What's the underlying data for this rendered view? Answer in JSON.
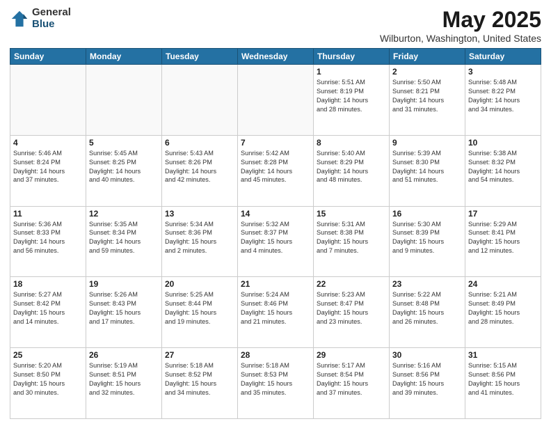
{
  "header": {
    "logo_general": "General",
    "logo_blue": "Blue",
    "title": "May 2025",
    "location": "Wilburton, Washington, United States"
  },
  "days_of_week": [
    "Sunday",
    "Monday",
    "Tuesday",
    "Wednesday",
    "Thursday",
    "Friday",
    "Saturday"
  ],
  "weeks": [
    [
      {
        "day": "",
        "info": ""
      },
      {
        "day": "",
        "info": ""
      },
      {
        "day": "",
        "info": ""
      },
      {
        "day": "",
        "info": ""
      },
      {
        "day": "1",
        "info": "Sunrise: 5:51 AM\nSunset: 8:19 PM\nDaylight: 14 hours\nand 28 minutes."
      },
      {
        "day": "2",
        "info": "Sunrise: 5:50 AM\nSunset: 8:21 PM\nDaylight: 14 hours\nand 31 minutes."
      },
      {
        "day": "3",
        "info": "Sunrise: 5:48 AM\nSunset: 8:22 PM\nDaylight: 14 hours\nand 34 minutes."
      }
    ],
    [
      {
        "day": "4",
        "info": "Sunrise: 5:46 AM\nSunset: 8:24 PM\nDaylight: 14 hours\nand 37 minutes."
      },
      {
        "day": "5",
        "info": "Sunrise: 5:45 AM\nSunset: 8:25 PM\nDaylight: 14 hours\nand 40 minutes."
      },
      {
        "day": "6",
        "info": "Sunrise: 5:43 AM\nSunset: 8:26 PM\nDaylight: 14 hours\nand 42 minutes."
      },
      {
        "day": "7",
        "info": "Sunrise: 5:42 AM\nSunset: 8:28 PM\nDaylight: 14 hours\nand 45 minutes."
      },
      {
        "day": "8",
        "info": "Sunrise: 5:40 AM\nSunset: 8:29 PM\nDaylight: 14 hours\nand 48 minutes."
      },
      {
        "day": "9",
        "info": "Sunrise: 5:39 AM\nSunset: 8:30 PM\nDaylight: 14 hours\nand 51 minutes."
      },
      {
        "day": "10",
        "info": "Sunrise: 5:38 AM\nSunset: 8:32 PM\nDaylight: 14 hours\nand 54 minutes."
      }
    ],
    [
      {
        "day": "11",
        "info": "Sunrise: 5:36 AM\nSunset: 8:33 PM\nDaylight: 14 hours\nand 56 minutes."
      },
      {
        "day": "12",
        "info": "Sunrise: 5:35 AM\nSunset: 8:34 PM\nDaylight: 14 hours\nand 59 minutes."
      },
      {
        "day": "13",
        "info": "Sunrise: 5:34 AM\nSunset: 8:36 PM\nDaylight: 15 hours\nand 2 minutes."
      },
      {
        "day": "14",
        "info": "Sunrise: 5:32 AM\nSunset: 8:37 PM\nDaylight: 15 hours\nand 4 minutes."
      },
      {
        "day": "15",
        "info": "Sunrise: 5:31 AM\nSunset: 8:38 PM\nDaylight: 15 hours\nand 7 minutes."
      },
      {
        "day": "16",
        "info": "Sunrise: 5:30 AM\nSunset: 8:39 PM\nDaylight: 15 hours\nand 9 minutes."
      },
      {
        "day": "17",
        "info": "Sunrise: 5:29 AM\nSunset: 8:41 PM\nDaylight: 15 hours\nand 12 minutes."
      }
    ],
    [
      {
        "day": "18",
        "info": "Sunrise: 5:27 AM\nSunset: 8:42 PM\nDaylight: 15 hours\nand 14 minutes."
      },
      {
        "day": "19",
        "info": "Sunrise: 5:26 AM\nSunset: 8:43 PM\nDaylight: 15 hours\nand 17 minutes."
      },
      {
        "day": "20",
        "info": "Sunrise: 5:25 AM\nSunset: 8:44 PM\nDaylight: 15 hours\nand 19 minutes."
      },
      {
        "day": "21",
        "info": "Sunrise: 5:24 AM\nSunset: 8:46 PM\nDaylight: 15 hours\nand 21 minutes."
      },
      {
        "day": "22",
        "info": "Sunrise: 5:23 AM\nSunset: 8:47 PM\nDaylight: 15 hours\nand 23 minutes."
      },
      {
        "day": "23",
        "info": "Sunrise: 5:22 AM\nSunset: 8:48 PM\nDaylight: 15 hours\nand 26 minutes."
      },
      {
        "day": "24",
        "info": "Sunrise: 5:21 AM\nSunset: 8:49 PM\nDaylight: 15 hours\nand 28 minutes."
      }
    ],
    [
      {
        "day": "25",
        "info": "Sunrise: 5:20 AM\nSunset: 8:50 PM\nDaylight: 15 hours\nand 30 minutes."
      },
      {
        "day": "26",
        "info": "Sunrise: 5:19 AM\nSunset: 8:51 PM\nDaylight: 15 hours\nand 32 minutes."
      },
      {
        "day": "27",
        "info": "Sunrise: 5:18 AM\nSunset: 8:52 PM\nDaylight: 15 hours\nand 34 minutes."
      },
      {
        "day": "28",
        "info": "Sunrise: 5:18 AM\nSunset: 8:53 PM\nDaylight: 15 hours\nand 35 minutes."
      },
      {
        "day": "29",
        "info": "Sunrise: 5:17 AM\nSunset: 8:54 PM\nDaylight: 15 hours\nand 37 minutes."
      },
      {
        "day": "30",
        "info": "Sunrise: 5:16 AM\nSunset: 8:56 PM\nDaylight: 15 hours\nand 39 minutes."
      },
      {
        "day": "31",
        "info": "Sunrise: 5:15 AM\nSunset: 8:56 PM\nDaylight: 15 hours\nand 41 minutes."
      }
    ]
  ]
}
